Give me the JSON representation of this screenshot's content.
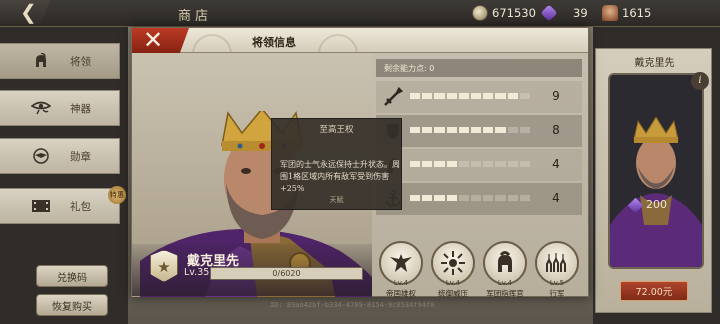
{
  "shop": {
    "title": "商店",
    "currencies": [
      {
        "name": "coin-icon",
        "value": "671530"
      },
      {
        "name": "gem-icon",
        "value": "39"
      },
      {
        "name": "helmet-icon",
        "value": "1615"
      }
    ],
    "sidebar": [
      {
        "label": "将领",
        "icon": "spartan-helmet-icon",
        "active": true
      },
      {
        "label": "神器",
        "icon": "eye-of-horus-icon",
        "active": false
      },
      {
        "label": "勋章",
        "icon": "eagle-medal-icon",
        "active": false
      },
      {
        "label": "礼包",
        "icon": "film-chest-icon",
        "active": false
      }
    ],
    "sidebar_badge": "特惠",
    "redeem_button": "兑换码",
    "restore_button": "恢复购买",
    "id_text": "ID: 89aa42bf-b334-4709-8154-9c0534f94f0"
  },
  "card": {
    "name": "戴克里先",
    "power": "200",
    "price": "72.00元"
  },
  "modal": {
    "title": "将领信息",
    "hero_name": "戴克里先",
    "level": "Lv.35",
    "xp": "0/6020",
    "remaining": "剩余能力点: 0",
    "stats": [
      {
        "icon": "sword-icon",
        "value": "9",
        "filled": 9
      },
      {
        "icon": "shield-icon",
        "value": "8",
        "filled": 8
      },
      {
        "icon": "horse-icon",
        "value": "4",
        "filled": 4
      },
      {
        "icon": "anchor-icon",
        "value": "4",
        "filled": 4
      }
    ],
    "tooltip": {
      "title": "至高王权",
      "body": "军团的士气永远保持士升状态。周围1格区域内所有敌军受到伤害+25%",
      "footer": "天赋"
    },
    "skills": [
      {
        "icon": "eagle-icon",
        "level": "Lv.4",
        "name": "帝国雄权"
      },
      {
        "icon": "sunburst-icon",
        "level": "Lv.4",
        "name": "统御威压"
      },
      {
        "icon": "helmet-icon",
        "level": "Lv.4",
        "name": "军团指挥官"
      },
      {
        "icon": "marching-army-icon",
        "level": "Lv.5",
        "name": "行军"
      }
    ]
  }
}
